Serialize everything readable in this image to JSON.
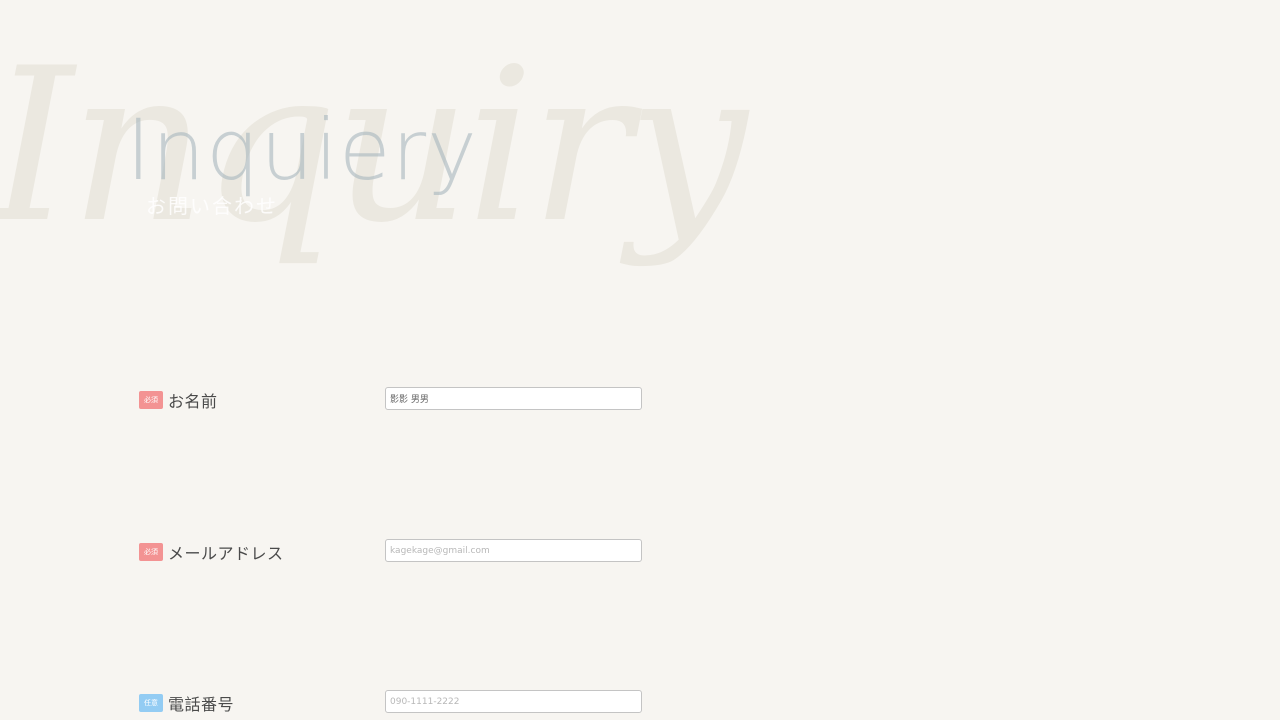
{
  "header": {
    "background_word": "Inquiry",
    "title": "Inquiery",
    "subtitle": "お問い合わせ"
  },
  "form": {
    "fields": [
      {
        "badge": "必須",
        "badge_type": "required",
        "label": "お名前",
        "value": "影影 男男",
        "placeholder": ""
      },
      {
        "badge": "必須",
        "badge_type": "required",
        "label": "メールアドレス",
        "value": "",
        "placeholder": "kagekage@gmail.com"
      },
      {
        "badge": "任意",
        "badge_type": "optional",
        "label": "電話番号",
        "value": "",
        "placeholder": "090-1111-2222"
      }
    ]
  },
  "colors": {
    "background": "#f7f5f1",
    "required_badge": "#f39393",
    "optional_badge": "#93ccf3",
    "label_text": "#4a4a4a"
  }
}
